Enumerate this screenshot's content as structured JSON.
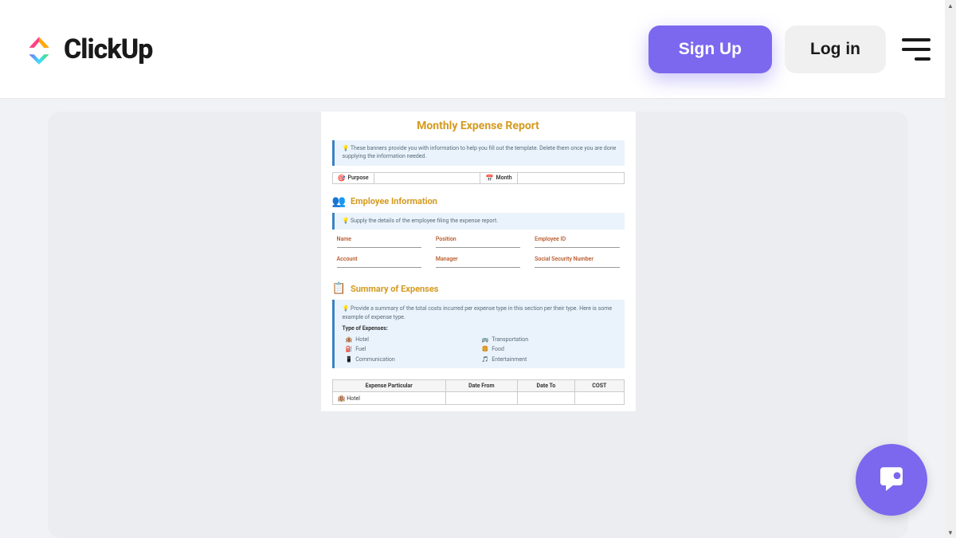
{
  "header": {
    "brand": "ClickUp",
    "signup": "Sign Up",
    "login": "Log in"
  },
  "doc": {
    "title": "Monthly Expense Report",
    "banner1": "These banners provide you with information to help you fill out the template. Delete them once you are done supplying the information needed.",
    "purpose_label": "Purpose",
    "month_label": "Month",
    "section_employee": "Employee Information",
    "banner2": "Supply the details of the employee filing the expense report.",
    "emp_fields": {
      "name": "Name",
      "position": "Position",
      "employee_id": "Employee ID",
      "account": "Account",
      "manager": "Manager",
      "ssn": "Social Security Number"
    },
    "section_summary": "Summary of Expenses",
    "banner3": "Provide a summary of the total costs incurred per expense type in this section per their type. Here is some example of expense type.",
    "types_label": "Type of Expenses:",
    "types": {
      "hotel": "Hotel",
      "transportation": "Transportation",
      "fuel": "Fuel",
      "food": "Food",
      "communication": "Communication",
      "entertainment": "Entertainment"
    },
    "table": {
      "col1": "Expense Particular",
      "col2": "Date From",
      "col3": "Date To",
      "col4": "COST",
      "row1": "Hotel"
    }
  }
}
